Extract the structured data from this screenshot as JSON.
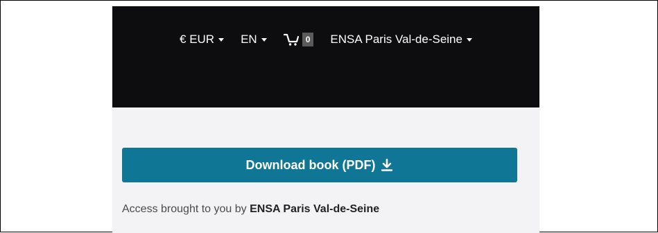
{
  "nav": {
    "currency": "€ EUR",
    "language": "EN",
    "cart_count": "0",
    "institution": "ENSA Paris Val-de-Seine",
    "cart_icon": "cart-icon"
  },
  "download": {
    "label": "Download book (PDF)",
    "icon": "download-icon"
  },
  "access": {
    "prefix": "Access brought to you by",
    "institution": "ENSA Paris Val-de-Seine"
  },
  "colors": {
    "header_bg": "#0d0d0f",
    "panel_bg": "#f3f3f5",
    "button_bg": "#107695",
    "cart_badge_bg": "#5a5a5a"
  }
}
